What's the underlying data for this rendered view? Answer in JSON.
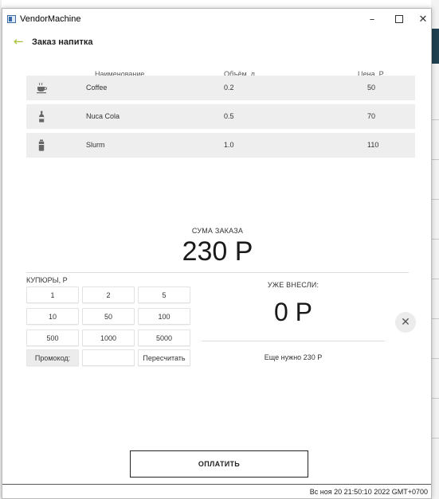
{
  "window": {
    "title": "VendorMachine"
  },
  "header": {
    "title": "Заказ напитка"
  },
  "table": {
    "columns": [
      "Наименование",
      "Объём, л",
      "Цена, Р"
    ],
    "rows": [
      {
        "icon": "coffee-cup-icon",
        "name": "Coffee",
        "volume": "0.2",
        "price": "50"
      },
      {
        "icon": "bottle-icon",
        "name": "Nuca Cola",
        "volume": "0.5",
        "price": "70"
      },
      {
        "icon": "can-icon",
        "name": "Slurm",
        "volume": "1.0",
        "price": "110"
      }
    ]
  },
  "order": {
    "label": "СУМА ЗАКАЗА",
    "total": "230 Р"
  },
  "bills": {
    "label": "КУПЮРЫ, Р",
    "values": [
      "1",
      "2",
      "5",
      "10",
      "50",
      "100",
      "500",
      "1000",
      "5000"
    ],
    "promo_label": "Промокод:",
    "promo_value": "",
    "recalc_label": "Пересчитать"
  },
  "paid": {
    "label": "УЖЕ ВНЕСЛИ:",
    "amount": "0 Р",
    "remaining": "Еще нужно 230 Р"
  },
  "pay_button": {
    "label": "ОПЛАТИТЬ"
  },
  "status": {
    "datetime": "Вс ноя 20 21:50:10 2022 GMT+0700"
  },
  "colors": {
    "accent": "#a6c13a",
    "row_bg": "#eeeeee",
    "text": "#222222"
  }
}
